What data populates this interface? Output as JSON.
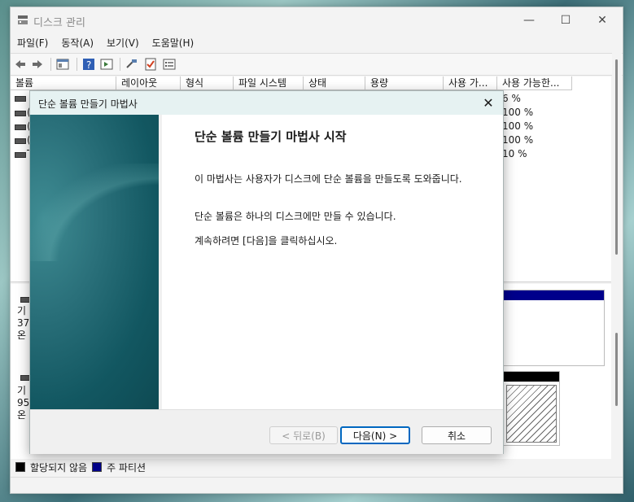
{
  "window": {
    "title": "디스크 관리",
    "controls": {
      "minimize": "—",
      "maximize": "☐",
      "close": "✕"
    }
  },
  "menu": [
    "파일(F)",
    "동작(A)",
    "보기(V)",
    "도움말(H)"
  ],
  "volume_table": {
    "columns": [
      "볼륨",
      "레이아웃",
      "형식",
      "파일 시스템",
      "상태",
      "용량",
      "사용 가...",
      "사용 가능한..."
    ],
    "rows": [
      {
        "partial": "",
        "free_pct": "6 %"
      },
      {
        "partial": "(",
        "free_pct": "100 %"
      },
      {
        "partial": "(",
        "free_pct": "100 %"
      },
      {
        "partial": "(",
        "free_pct": "100 %"
      },
      {
        "partial": "T",
        "free_pct": "10 %"
      }
    ]
  },
  "disks": [
    {
      "line1": "기",
      "line2": "37",
      "line3": "온"
    },
    {
      "line1": "기",
      "line2": "95",
      "line3": "온"
    }
  ],
  "legend": [
    {
      "label": "할당되지 않음",
      "color": "#000000"
    },
    {
      "label": "주 파티션",
      "color": "#00008b"
    }
  ],
  "dialog": {
    "title": "단순 볼륨 만들기 마법사",
    "heading": "단순 볼륨 만들기 마법사 시작",
    "para1": "이 마법사는 사용자가 디스크에 단순 볼륨을 만들도록 도와줍니다.",
    "para2": "단순 볼륨은 하나의 디스크에만 만들 수 있습니다.",
    "para3": "계속하려면 [다음]을 클릭하십시오.",
    "back_label": "< 뒤로(B)",
    "next_label": "다음(N) >",
    "cancel_label": "취소"
  },
  "colors": {
    "primary_partition": "#00008b",
    "unallocated": "#000000",
    "accent": "#0067c0"
  }
}
